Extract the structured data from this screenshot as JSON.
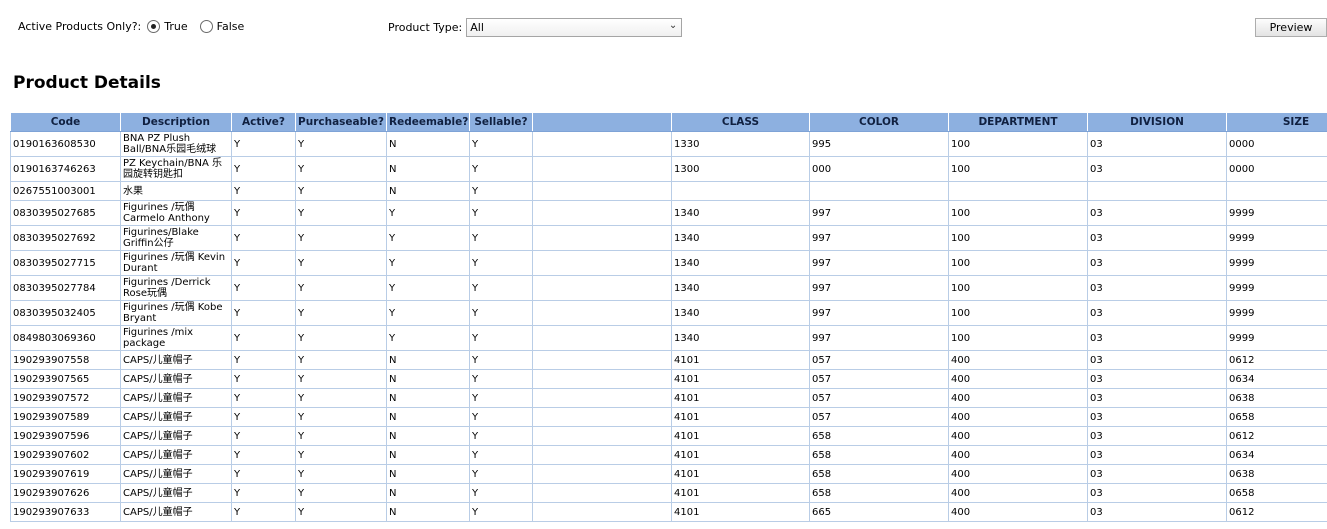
{
  "filters": {
    "active_label": "Active Products Only?:",
    "true_label": "True",
    "false_label": "False",
    "active_selected": "True",
    "type_label": "Product Type:",
    "type_value": "All",
    "preview_label": "Preview"
  },
  "section": {
    "title": "Product Details"
  },
  "table": {
    "headers": [
      "Code",
      "Description",
      "Active?",
      "Purchaseable?",
      "Redeemable?",
      "Sellable?",
      "",
      "CLASS",
      "COLOR",
      "DEPARTMENT",
      "DIVISION",
      "SIZE"
    ],
    "rows": [
      [
        "0190163608530",
        "BNA PZ Plush Ball/BNA乐园毛绒球",
        "Y",
        "Y",
        "N",
        "Y",
        "",
        "1330",
        "995",
        "100",
        "03",
        "0000"
      ],
      [
        "0190163746263",
        "PZ Keychain/BNA 乐园旋转钥匙扣",
        "Y",
        "Y",
        "N",
        "Y",
        "",
        "1300",
        "000",
        "100",
        "03",
        "0000"
      ],
      [
        "0267551003001",
        "水果",
        "Y",
        "Y",
        "N",
        "Y",
        "",
        "",
        "",
        "",
        "",
        ""
      ],
      [
        "0830395027685",
        "Figurines /玩偶 Carmelo Anthony",
        "Y",
        "Y",
        "Y",
        "Y",
        "",
        "1340",
        "997",
        "100",
        "03",
        "9999"
      ],
      [
        "0830395027692",
        "Figurines/Blake Griffin公仔",
        "Y",
        "Y",
        "Y",
        "Y",
        "",
        "1340",
        "997",
        "100",
        "03",
        "9999"
      ],
      [
        "0830395027715",
        "Figurines /玩偶 Kevin Durant",
        "Y",
        "Y",
        "Y",
        "Y",
        "",
        "1340",
        "997",
        "100",
        "03",
        "9999"
      ],
      [
        "0830395027784",
        "Figurines /Derrick Rose玩偶",
        "Y",
        "Y",
        "Y",
        "Y",
        "",
        "1340",
        "997",
        "100",
        "03",
        "9999"
      ],
      [
        "0830395032405",
        "Figurines /玩偶 Kobe Bryant",
        "Y",
        "Y",
        "Y",
        "Y",
        "",
        "1340",
        "997",
        "100",
        "03",
        "9999"
      ],
      [
        "0849803069360",
        "Figurines /mix package",
        "Y",
        "Y",
        "Y",
        "Y",
        "",
        "1340",
        "997",
        "100",
        "03",
        "9999"
      ],
      [
        "190293907558",
        "CAPS/儿童帽子",
        "Y",
        "Y",
        "N",
        "Y",
        "",
        "4101",
        "057",
        "400",
        "03",
        "0612"
      ],
      [
        "190293907565",
        "CAPS/儿童帽子",
        "Y",
        "Y",
        "N",
        "Y",
        "",
        "4101",
        "057",
        "400",
        "03",
        "0634"
      ],
      [
        "190293907572",
        "CAPS/儿童帽子",
        "Y",
        "Y",
        "N",
        "Y",
        "",
        "4101",
        "057",
        "400",
        "03",
        "0638"
      ],
      [
        "190293907589",
        "CAPS/儿童帽子",
        "Y",
        "Y",
        "N",
        "Y",
        "",
        "4101",
        "057",
        "400",
        "03",
        "0658"
      ],
      [
        "190293907596",
        "CAPS/儿童帽子",
        "Y",
        "Y",
        "N",
        "Y",
        "",
        "4101",
        "658",
        "400",
        "03",
        "0612"
      ],
      [
        "190293907602",
        "CAPS/儿童帽子",
        "Y",
        "Y",
        "N",
        "Y",
        "",
        "4101",
        "658",
        "400",
        "03",
        "0634"
      ],
      [
        "190293907619",
        "CAPS/儿童帽子",
        "Y",
        "Y",
        "N",
        "Y",
        "",
        "4101",
        "658",
        "400",
        "03",
        "0638"
      ],
      [
        "190293907626",
        "CAPS/儿童帽子",
        "Y",
        "Y",
        "N",
        "Y",
        "",
        "4101",
        "658",
        "400",
        "03",
        "0658"
      ],
      [
        "190293907633",
        "CAPS/儿童帽子",
        "Y",
        "Y",
        "N",
        "Y",
        "",
        "4101",
        "665",
        "400",
        "03",
        "0612"
      ]
    ]
  },
  "colors": {
    "header_bg": "#8db0e0",
    "grid_line": "#b9cde6"
  },
  "icons": {
    "dropdown": "chevron-down-icon"
  }
}
